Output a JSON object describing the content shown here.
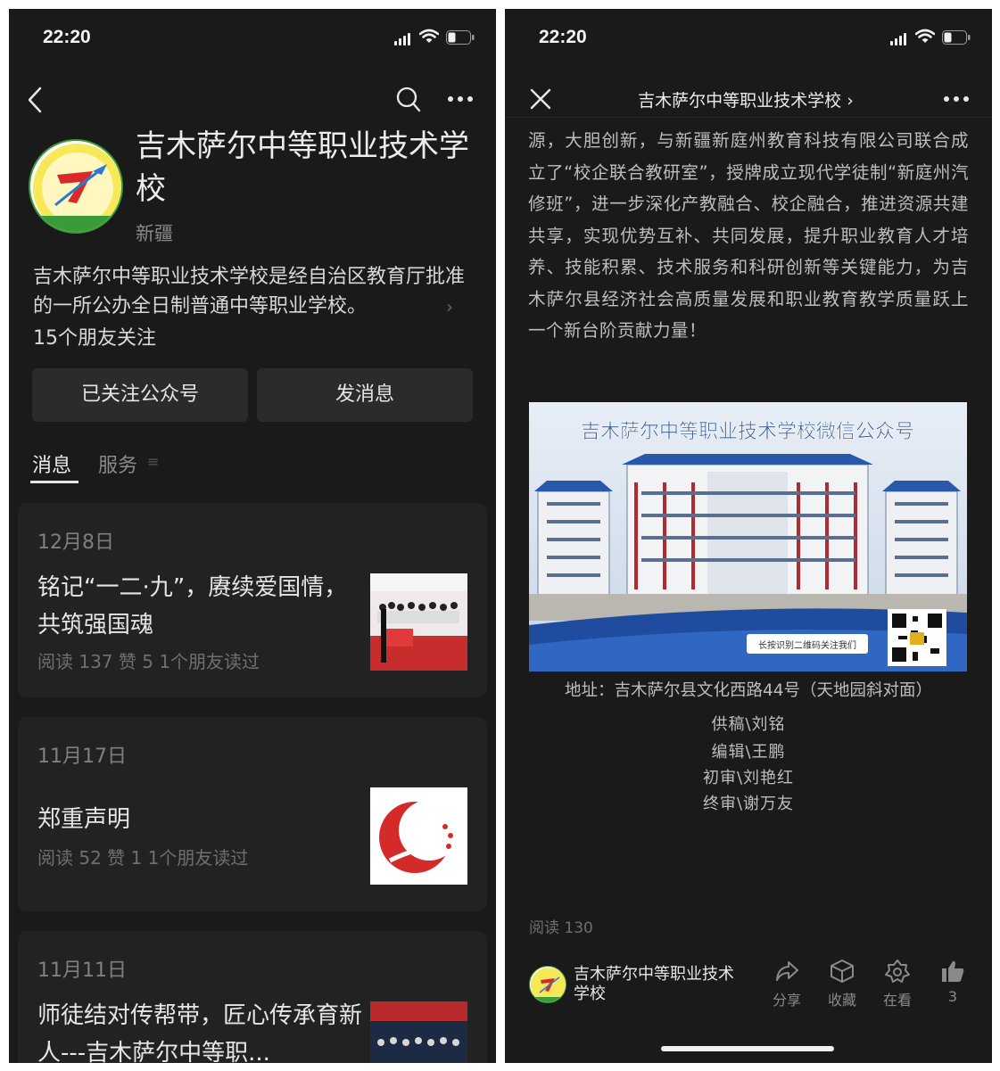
{
  "left": {
    "status": {
      "time": "22:20"
    },
    "account": {
      "name": "吉木萨尔中等职业技术学校",
      "region": "新疆",
      "description": "吉木萨尔中等职业技术学校是经自治区教育厅批准的一所公办全日制普通中等职业学校。",
      "friends_following": "15个朋友关注"
    },
    "buttons": {
      "followed": "已关注公众号",
      "message": "发消息"
    },
    "tabs": {
      "messages": "消息",
      "services": "服务"
    },
    "posts": [
      {
        "date": "12月8日",
        "title": "铭记“一二·九”，赓续爱国情，共筑强国魂",
        "stats": "阅读 137  赞 5  1个朋友读过"
      },
      {
        "date": "11月17日",
        "title": "郑重声明",
        "stats": "阅读 52  赞 1  1个朋友读过"
      },
      {
        "date": "11月11日",
        "title": "师徒结对传帮带，匠心传承育新人---吉木萨尔中等职...",
        "stats": ""
      }
    ],
    "icons": [
      "back-icon",
      "search-icon",
      "more-icon",
      "signal-icon",
      "wifi-icon",
      "battery-icon"
    ]
  },
  "right": {
    "status": {
      "time": "22:20"
    },
    "header": {
      "title": "吉木萨尔中等职业技术学校 ›"
    },
    "article": {
      "text": "源，大胆创新，与新疆新庭州教育科技有限公司联合成立了“校企联合教研室”，授牌成立现代学徒制“新庭州汽修班”，进一步深化产教融合、校企融合，推进资源共建共享，实现优势互补、共同发展，提升职业教育人才培养、技能积累、技术服务和科研创新等关键能力，为吉木萨尔县经济社会高质量发展和职业教育教学质量跃上一个新台阶贡献力量！",
      "banner": {
        "heading": "吉木萨尔中等职业技术学校微信公众号",
        "scan_hint": "长按识别二维码关注我们"
      },
      "address": "地址：吉木萨尔县文化西路44号（天地园斜对面）",
      "credits": [
        "供稿\\刘铭",
        "编辑\\王鹏",
        "初审\\刘艳红",
        "终审\\谢万友"
      ],
      "reads": "阅读 130"
    },
    "footer": {
      "account_name": "吉木萨尔中等职业技术学校",
      "actions": {
        "share": "分享",
        "favorite": "收藏",
        "wow": "在看",
        "like_count": "3"
      }
    },
    "icons": [
      "close-icon",
      "more-icon",
      "share-icon",
      "favorite-icon",
      "wow-icon",
      "like-icon"
    ]
  }
}
